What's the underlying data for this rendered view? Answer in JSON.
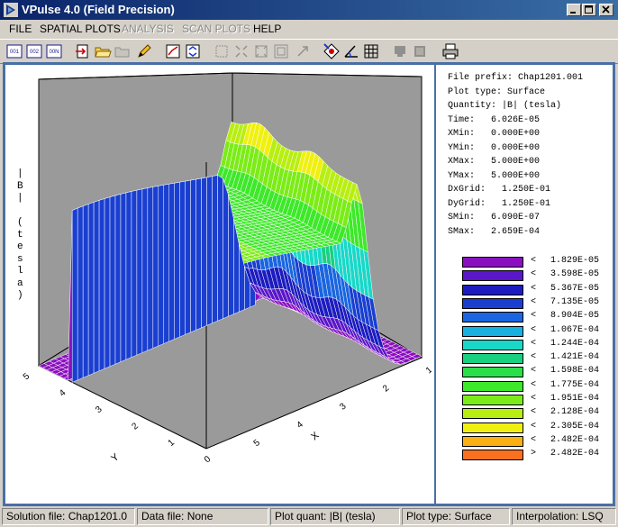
{
  "window": {
    "title": "VPulse 4.0 (Field Precision)"
  },
  "menu": [
    {
      "label": "FILE",
      "enabled": true
    },
    {
      "label": "SPATIAL PLOTS",
      "enabled": true
    },
    {
      "label": "ANALYSIS",
      "enabled": false
    },
    {
      "label": "SCAN PLOTS",
      "enabled": false
    },
    {
      "label": "HELP",
      "enabled": true
    }
  ],
  "toolbar": {
    "btn1": "001",
    "btn2": "002",
    "btn3": "00N"
  },
  "plot": {
    "y_axis_title": [
      "|",
      "B",
      "|",
      "",
      "(",
      "t",
      "e",
      "s",
      "l",
      "a",
      ")"
    ],
    "left_axis_label": "Y",
    "right_axis_label": "X",
    "left_ticks": [
      "5",
      "4",
      "3",
      "2",
      "1",
      "0"
    ],
    "right_ticks": [
      "5",
      "4",
      "3",
      "2",
      "1"
    ]
  },
  "info": {
    "lines": [
      "File prefix: Chap1201.001",
      "Plot type: Surface",
      "Quantity: |B| (tesla)",
      "Time:   6.026E-05",
      "XMin:   0.000E+00",
      "YMin:   0.000E+00",
      "XMax:   5.000E+00",
      "YMax:   5.000E+00",
      "DxGrid:   1.250E-01",
      "DyGrid:   1.250E-01",
      "SMin:   6.090E-07",
      "SMax:   2.659E-04"
    ]
  },
  "legend": [
    {
      "sym": "<",
      "value": "1.829E-05",
      "color": "#8a0fbf"
    },
    {
      "sym": "<",
      "value": "3.598E-05",
      "color": "#5a16c8"
    },
    {
      "sym": "<",
      "value": "5.367E-05",
      "color": "#1c1cc0"
    },
    {
      "sym": "<",
      "value": "7.135E-05",
      "color": "#1a3fd0"
    },
    {
      "sym": "<",
      "value": "8.904E-05",
      "color": "#1a66e0"
    },
    {
      "sym": "<",
      "value": "1.067E-04",
      "color": "#17b0e0"
    },
    {
      "sym": "<",
      "value": "1.244E-04",
      "color": "#1ad8c8"
    },
    {
      "sym": "<",
      "value": "1.421E-04",
      "color": "#17d080"
    },
    {
      "sym": "<",
      "value": "1.598E-04",
      "color": "#2ae04a"
    },
    {
      "sym": "<",
      "value": "1.775E-04",
      "color": "#3ee82a"
    },
    {
      "sym": "<",
      "value": "1.951E-04",
      "color": "#7cec18"
    },
    {
      "sym": "<",
      "value": "2.128E-04",
      "color": "#b8ee12"
    },
    {
      "sym": "<",
      "value": "2.305E-04",
      "color": "#f0f010"
    },
    {
      "sym": "<",
      "value": "2.482E-04",
      "color": "#f8b012"
    },
    {
      "sym": ">",
      "value": "2.482E-04",
      "color": "#f87020"
    }
  ],
  "status": {
    "solution": "Solution file: Chap1201.0",
    "data": "Data file: None",
    "quant": "Plot quant: |B| (tesla)",
    "type": "Plot type: Surface",
    "interp": "Interpolation: LSQ"
  }
}
